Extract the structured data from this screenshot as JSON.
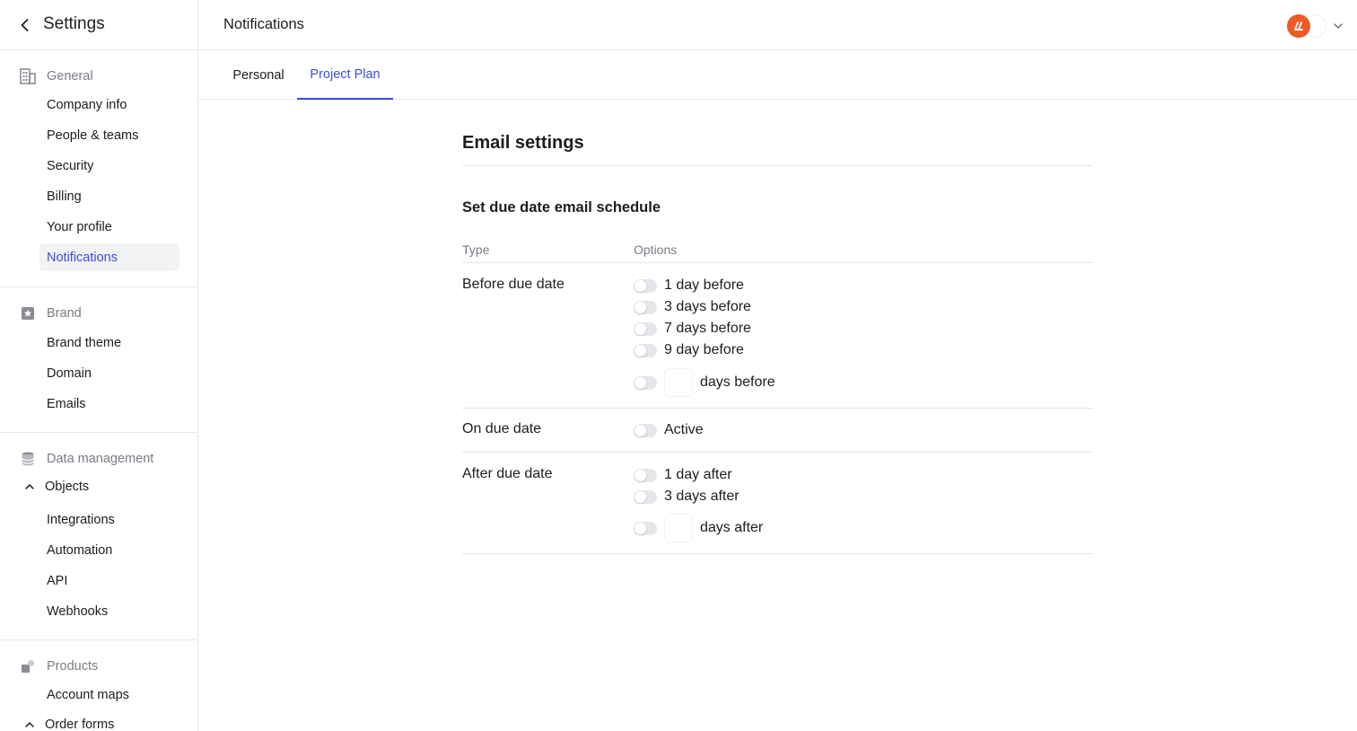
{
  "sidebar": {
    "title": "Settings",
    "groups": [
      {
        "label": "General",
        "icon": "building-icon",
        "items": [
          "Company info",
          "People & teams",
          "Security",
          "Billing",
          "Your profile",
          "Notifications"
        ]
      },
      {
        "label": "Brand",
        "icon": "star-badge-icon",
        "items": [
          "Brand theme",
          "Domain",
          "Emails"
        ]
      },
      {
        "label": "Data management",
        "icon": "database-icon",
        "collapsible": "Objects",
        "items": [
          "Integrations",
          "Automation",
          "API",
          "Webhooks"
        ]
      },
      {
        "label": "Products",
        "icon": "products-icon",
        "items": [
          "Account maps"
        ],
        "collapsible": "Order forms"
      }
    ],
    "active_item": "Notifications"
  },
  "header": {
    "title": "Notifications"
  },
  "tabs": [
    {
      "label": "Personal",
      "active": false
    },
    {
      "label": "Project Plan",
      "active": true
    }
  ],
  "email_settings": {
    "title": "Email settings",
    "subtitle": "Set due date email schedule",
    "columns": {
      "type": "Type",
      "options": "Options"
    },
    "rows": [
      {
        "type": "Before due date",
        "options": [
          "1 day before",
          "3 days before",
          "7 days before",
          "9 day before"
        ],
        "custom_suffix": "days before",
        "custom_value": ""
      },
      {
        "type": "On due date",
        "options": [
          "Active"
        ]
      },
      {
        "type": "After due date",
        "options": [
          "1 day after",
          "3 days after"
        ],
        "custom_suffix": "days after",
        "custom_value": ""
      }
    ]
  },
  "colors": {
    "accent": "#3a4ed8",
    "brand_logo": "#ee5a24",
    "toggle_off": "#e4e6ea"
  }
}
